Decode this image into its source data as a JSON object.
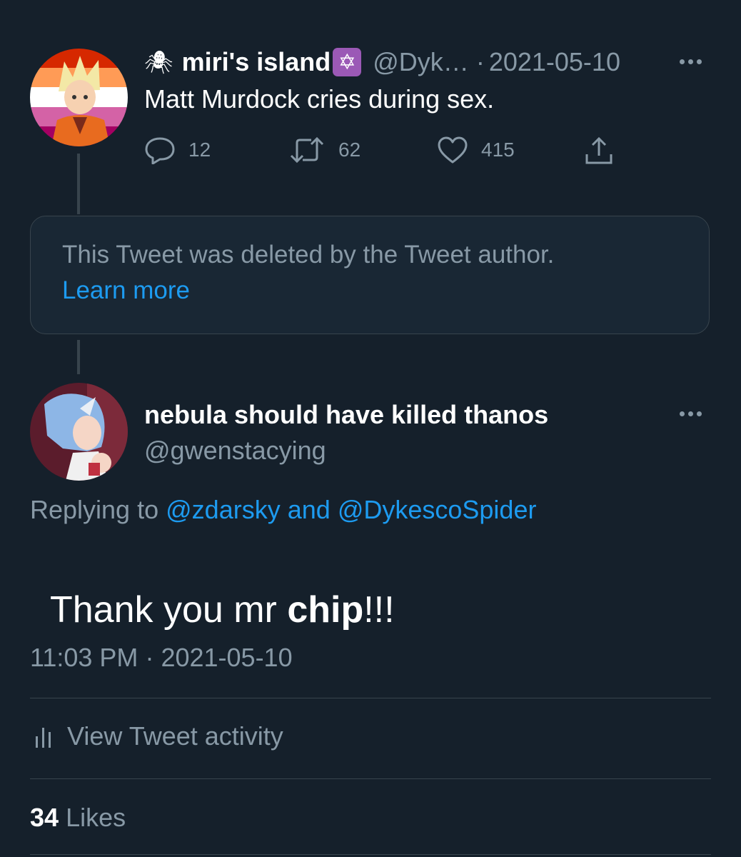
{
  "parent_tweet": {
    "display_name": "miri's island",
    "name_prefix_emoji": "🕷",
    "name_suffix_emoji": "✡",
    "handle": "@Dyk…",
    "separator": "·",
    "date": "2021-05-10",
    "text": "Matt Murdock cries during sex.",
    "replies": "12",
    "retweets": "62",
    "likes": "415",
    "avatar_flag_colors": [
      "#d62800",
      "#ff9b56",
      "#ffffff",
      "#d462a6",
      "#a40062"
    ]
  },
  "deleted_notice": {
    "text": "This Tweet was deleted by the Tweet author.",
    "link": "Learn more"
  },
  "main_tweet": {
    "display_name": "nebula should have killed thanos",
    "handle": "@gwenstacying",
    "replying_prefix": "Replying to",
    "reply_to_1": "@zdarsky",
    "reply_to_joiner": "and",
    "reply_to_2": "@DykescoSpider",
    "text_before": "Thank you mr ",
    "text_bold": "chip",
    "text_after": "!!!",
    "time": "11:03 PM",
    "separator": "·",
    "date": "2021-05-10",
    "activity_label": "View Tweet activity",
    "likes_count": "34",
    "likes_label": "Likes"
  },
  "colors": {
    "background": "#15202b",
    "link": "#1d9bf0",
    "muted": "#8899a6",
    "border": "#38444d"
  }
}
